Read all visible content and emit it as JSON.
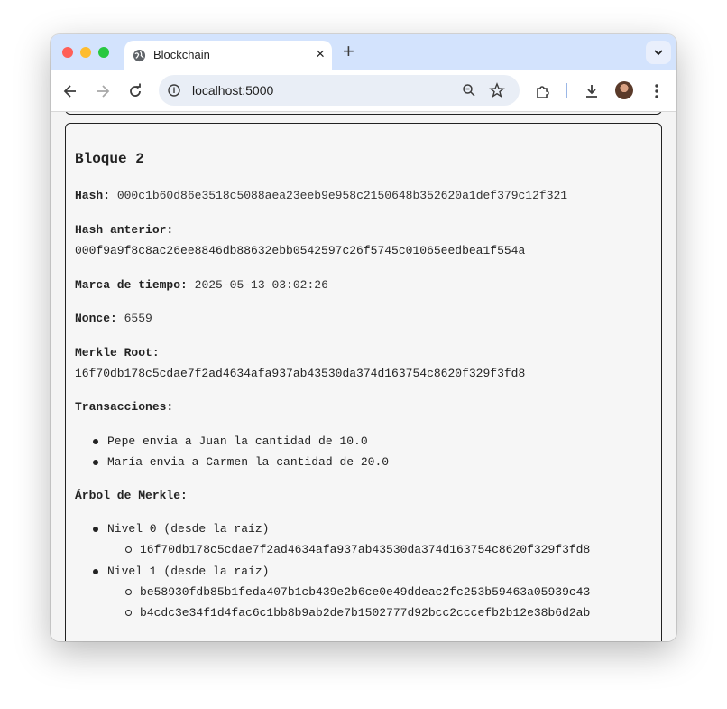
{
  "browser": {
    "tab_title": "Blockchain",
    "tab_close": "×",
    "new_tab": "+",
    "url": "localhost:5000"
  },
  "block": {
    "title": "Bloque 2",
    "hash_label": "Hash:",
    "hash": "000c1b60d86e3518c5088aea23eeb9e958c2150648b352620a1def379c12f321",
    "prev_hash_label": "Hash anterior:",
    "prev_hash": "000f9a9f8c8ac26ee8846db88632ebb0542597c26f5745c01065eedbea1f554a",
    "timestamp_label": "Marca de tiempo:",
    "timestamp": "2025-05-13 03:02:26",
    "nonce_label": "Nonce:",
    "nonce": "6559",
    "merkle_root_label": "Merkle Root:",
    "merkle_root": "16f70db178c5cdae7f2ad4634afa937ab43530da374d163754c8620f329f3fd8",
    "transactions_label": "Transacciones:",
    "transactions": [
      "Pepe envia a Juan la cantidad de 10.0",
      "María envia a Carmen la cantidad de 20.0"
    ],
    "merkle_tree_label": "Árbol de Merkle:",
    "merkle_levels": [
      {
        "label": "Nivel 0 (desde la raíz)",
        "hashes": [
          "16f70db178c5cdae7f2ad4634afa937ab43530da374d163754c8620f329f3fd8"
        ]
      },
      {
        "label": "Nivel 1 (desde la raíz)",
        "hashes": [
          "be58930fdb85b1feda407b1cb439e2b6ce0e49ddeac2fc253b59463a05939c43",
          "b4cdc3e34f1d4fac6c1bb8b9ab2de7b1502777d92bcc2cccefb2b12e38b6d2ab"
        ]
      }
    ]
  }
}
